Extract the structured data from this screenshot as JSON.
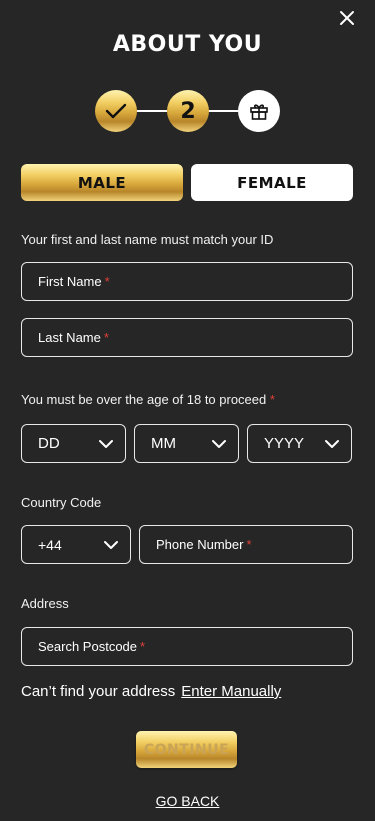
{
  "header": {
    "title": "ABOUT YOU",
    "close_icon": "close-icon"
  },
  "stepper": {
    "steps": [
      {
        "state": "done",
        "icon": "check-icon"
      },
      {
        "state": "current",
        "label": "2"
      },
      {
        "state": "upcoming",
        "icon": "gift-icon"
      }
    ]
  },
  "gender": {
    "male_label": "MALE",
    "female_label": "FEMALE",
    "selected": "MALE"
  },
  "name_section": {
    "hint": "Your first and last name must match your ID",
    "first_name_placeholder": "First Name",
    "last_name_placeholder": "Last Name",
    "required_mark": "*"
  },
  "dob_section": {
    "hint": "You must be over the age of 18 to proceed",
    "day_value": "DD",
    "month_value": "MM",
    "year_value": "YYYY"
  },
  "phone_section": {
    "country_code_label": "Country Code",
    "country_code_value": "+44",
    "phone_placeholder": "Phone Number"
  },
  "address_section": {
    "label": "Address",
    "postcode_placeholder": "Search Postcode",
    "cant_find_text": "Can’t find your address",
    "manual_link": "Enter Manually"
  },
  "actions": {
    "continue_label": "CONTINUE",
    "go_back_label": "GO BACK"
  },
  "colors": {
    "background": "#262626",
    "gold_light": "#fff3b0",
    "gold_dark": "#b8862a",
    "required": "#e0413a"
  }
}
